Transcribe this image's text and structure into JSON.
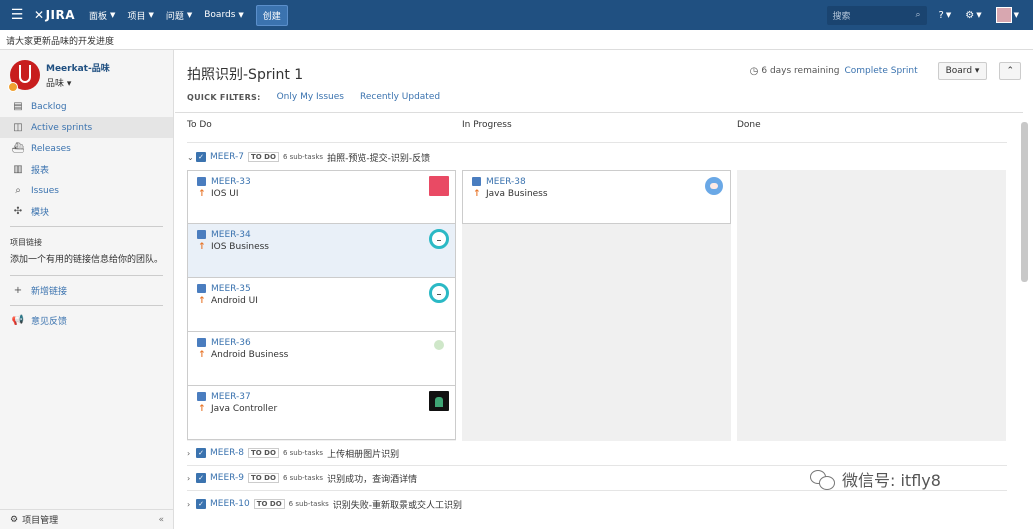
{
  "topnav": {
    "logo": "JIRA",
    "menus": [
      "面板",
      "项目",
      "问题",
      "Boards"
    ],
    "create_label": "创建",
    "search_placeholder": "搜索"
  },
  "announcement": "请大家更新品味的开发进度",
  "sidebar": {
    "project_name": "Meerkat-品味",
    "project_sub": "品味",
    "items": [
      {
        "label": "Backlog",
        "icon": "backlog-icon"
      },
      {
        "label": "Active sprints",
        "icon": "board-icon"
      },
      {
        "label": "Releases",
        "icon": "ship-icon"
      },
      {
        "label": "报表",
        "icon": "chart-icon"
      },
      {
        "label": "Issues",
        "icon": "search-issues-icon"
      },
      {
        "label": "模块",
        "icon": "puzzle-icon"
      }
    ],
    "links_heading": "项目链接",
    "links_text": "添加一个有用的链接信息给你的团队。",
    "add_link": "新增链接",
    "feedback": "意见反馈",
    "admin": "项目管理"
  },
  "board": {
    "title": "拍照识别-Sprint 1",
    "remaining": "6 days remaining",
    "complete": "Complete Sprint",
    "board_btn": "Board",
    "quick_filters_label": "QUICK FILTERS:",
    "filters": [
      "Only My Issues",
      "Recently Updated"
    ],
    "columns": [
      "To Do",
      "In Progress",
      "Done"
    ],
    "swimlanes": [
      {
        "key": "MEER-7",
        "status": "TO DO",
        "subtasks": "6 sub-tasks",
        "summary": "拍照-预览-提交-识别-反馈"
      },
      {
        "key": "MEER-8",
        "status": "TO DO",
        "subtasks": "6 sub-tasks",
        "summary": "上传相册图片识别"
      },
      {
        "key": "MEER-9",
        "status": "TO DO",
        "subtasks": "6 sub-tasks",
        "summary": "识别成功，查询酒详情"
      },
      {
        "key": "MEER-10",
        "status": "TO DO",
        "subtasks": "6 sub-tasks",
        "summary": "识别失败-重新取景或交人工识别"
      }
    ],
    "todo_cards": [
      {
        "key": "MEER-33",
        "summary": "IOS UI",
        "avatar": "red"
      },
      {
        "key": "MEER-34",
        "summary": "IOS Business",
        "avatar": "cyan"
      },
      {
        "key": "MEER-35",
        "summary": "Android UI",
        "avatar": "cyan"
      },
      {
        "key": "MEER-36",
        "summary": "Android Business",
        "avatar": "green"
      },
      {
        "key": "MEER-37",
        "summary": "Java Controller",
        "avatar": "dark"
      }
    ],
    "progress_cards": [
      {
        "key": "MEER-38",
        "summary": "Java Business",
        "avatar": "anime"
      }
    ]
  },
  "watermark": "微信号: itfly8"
}
